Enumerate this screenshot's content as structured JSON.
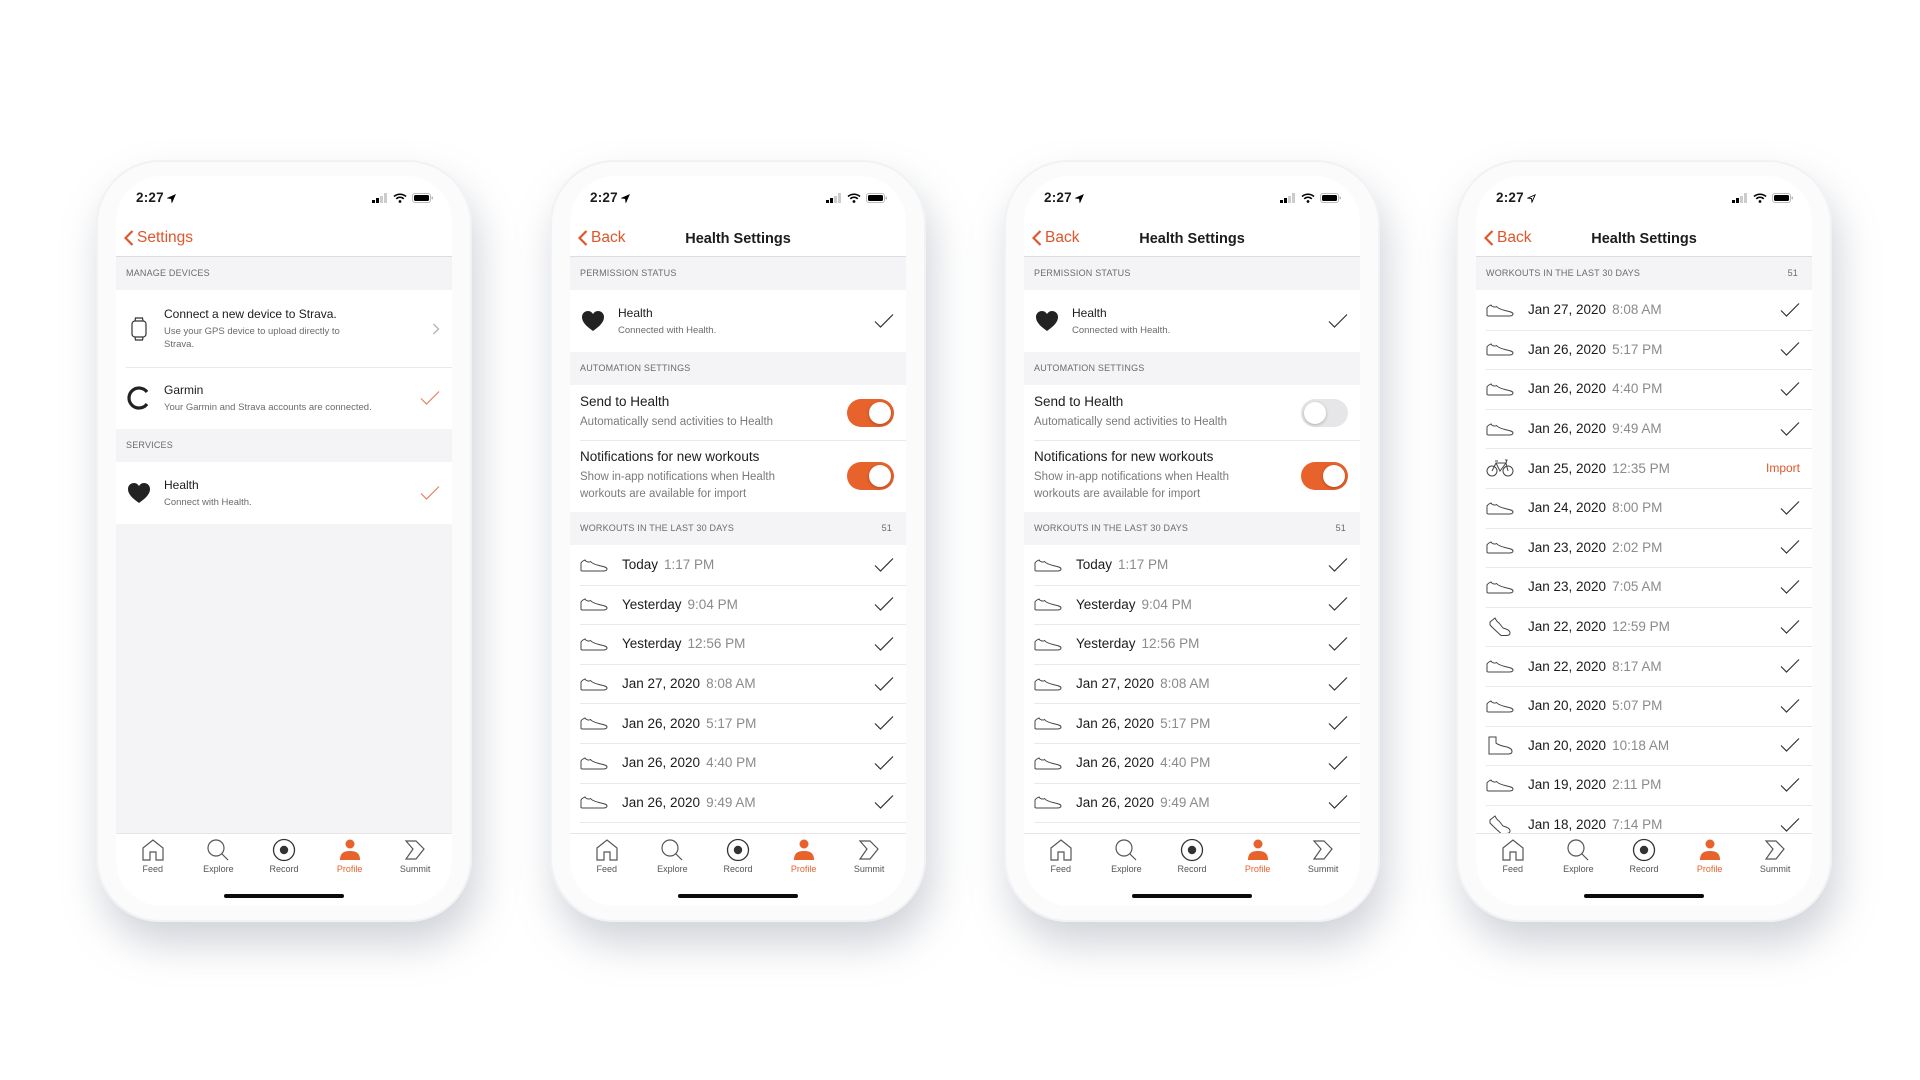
{
  "status_bar": {
    "time": "2:27"
  },
  "colors": {
    "accent": "#e8622c",
    "toggle_off": "#e6e6e9",
    "section_bg": "#f4f4f6"
  },
  "tab_bar": {
    "tabs": [
      {
        "label": "Feed",
        "icon": "home-icon"
      },
      {
        "label": "Explore",
        "icon": "search-icon"
      },
      {
        "label": "Record",
        "icon": "record-icon"
      },
      {
        "label": "Profile",
        "icon": "profile-icon",
        "active": true
      },
      {
        "label": "Summit",
        "icon": "summit-icon"
      }
    ]
  },
  "screen1": {
    "back_label": "Settings",
    "manage_devices_header": "MANAGE DEVICES",
    "connect_device": {
      "title": "Connect a new device to Strava.",
      "subtitle": "Use your GPS device to upload directly to Strava.",
      "icon": "watch-icon",
      "accessory": "chevron-right-icon"
    },
    "garmin": {
      "title": "Garmin",
      "subtitle": "Your Garmin and Strava accounts are connected.",
      "icon": "garmin-icon",
      "accessory": "check-icon"
    },
    "services_header": "SERVICES",
    "health": {
      "title": "Health",
      "subtitle": "Connect with Health.",
      "icon": "heart-icon",
      "accessory": "check-icon"
    }
  },
  "health_settings": {
    "back_label": "Back",
    "title": "Health Settings",
    "permission_header": "PERMISSION STATUS",
    "permission": {
      "title": "Health",
      "subtitle": "Connected with Health."
    },
    "automation_header": "AUTOMATION SETTINGS",
    "send_to_health": {
      "title": "Send to Health",
      "subtitle": "Automatically send activities to Health"
    },
    "notifications": {
      "title": "Notifications for new workouts",
      "subtitle": "Show in-app notifications when Health workouts are available for import"
    },
    "workouts_header": "WORKOUTS IN THE LAST 30 DAYS",
    "workouts_count": "51",
    "import_label": "Import"
  },
  "screen2": {
    "send_to_health_on": true,
    "notifications_on": true
  },
  "screen3": {
    "send_to_health_on": false,
    "notifications_on": true
  },
  "workouts_short": [
    {
      "date": "Today",
      "time": "1:17 PM",
      "type": "run",
      "status": "imported"
    },
    {
      "date": "Yesterday",
      "time": "9:04 PM",
      "type": "run",
      "status": "imported"
    },
    {
      "date": "Yesterday",
      "time": "12:56 PM",
      "type": "run",
      "status": "imported"
    },
    {
      "date": "Jan 27, 2020",
      "time": "8:08 AM",
      "type": "run",
      "status": "imported"
    },
    {
      "date": "Jan 26, 2020",
      "time": "5:17 PM",
      "type": "run",
      "status": "imported"
    },
    {
      "date": "Jan 26, 2020",
      "time": "4:40 PM",
      "type": "run",
      "status": "imported"
    },
    {
      "date": "Jan 26, 2020",
      "time": "9:49 AM",
      "type": "run",
      "status": "imported"
    }
  ],
  "workouts_long": [
    {
      "date": "Jan 27, 2020",
      "time": "8:08 AM",
      "type": "run",
      "status": "imported"
    },
    {
      "date": "Jan 26, 2020",
      "time": "5:17 PM",
      "type": "run",
      "status": "imported"
    },
    {
      "date": "Jan 26, 2020",
      "time": "4:40 PM",
      "type": "run",
      "status": "imported"
    },
    {
      "date": "Jan 26, 2020",
      "time": "9:49 AM",
      "type": "run",
      "status": "imported"
    },
    {
      "date": "Jan 25, 2020",
      "time": "12:35 PM",
      "type": "ride",
      "status": "import"
    },
    {
      "date": "Jan 24, 2020",
      "time": "8:00 PM",
      "type": "run",
      "status": "imported"
    },
    {
      "date": "Jan 23, 2020",
      "time": "2:02 PM",
      "type": "run",
      "status": "imported"
    },
    {
      "date": "Jan 23, 2020",
      "time": "7:05 AM",
      "type": "run",
      "status": "imported"
    },
    {
      "date": "Jan 22, 2020",
      "time": "12:59 PM",
      "type": "walk",
      "status": "imported"
    },
    {
      "date": "Jan 22, 2020",
      "time": "8:17 AM",
      "type": "run",
      "status": "imported"
    },
    {
      "date": "Jan 20, 2020",
      "time": "5:07 PM",
      "type": "run",
      "status": "imported"
    },
    {
      "date": "Jan 20, 2020",
      "time": "10:18 AM",
      "type": "hike",
      "status": "imported"
    },
    {
      "date": "Jan 19, 2020",
      "time": "2:11 PM",
      "type": "run",
      "status": "imported"
    },
    {
      "date": "Jan 18, 2020",
      "time": "7:14 PM",
      "type": "walk",
      "status": "imported"
    }
  ]
}
